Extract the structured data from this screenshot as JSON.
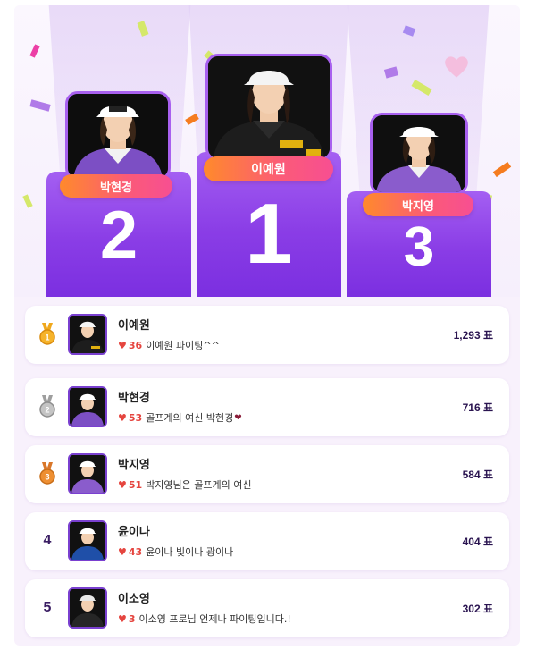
{
  "podium": [
    {
      "place": "1",
      "name": "이예원"
    },
    {
      "place": "2",
      "name": "박현경"
    },
    {
      "place": "3",
      "name": "박지영"
    }
  ],
  "ranking": [
    {
      "rank": "1",
      "rank_icon": "gold-medal-icon",
      "name": "이예원",
      "heart_count": "36",
      "message": "이예원 파이팅^^",
      "votes": "1,293 표"
    },
    {
      "rank": "2",
      "rank_icon": "silver-medal-icon",
      "name": "박현경",
      "heart_count": "53",
      "message": "골프계의 여신 박현경",
      "message_suffix_icon": "heart-icon",
      "votes": "716 표"
    },
    {
      "rank": "3",
      "rank_icon": "bronze-medal-icon",
      "name": "박지영",
      "heart_count": "51",
      "message": "박지영님은 골프계의 여신",
      "votes": "584 표"
    },
    {
      "rank": "4",
      "name": "윤이나",
      "heart_count": "43",
      "message": "윤이나 빛이나 광이나",
      "votes": "404 표"
    },
    {
      "rank": "5",
      "name": "이소영",
      "heart_count": "3",
      "message": "이소영 프로님 언제나 파이팅입니다.!",
      "votes": "302 표"
    }
  ],
  "colors": {
    "podium": "#8a3de6",
    "name_pill_start": "#ff8a2b",
    "name_pill_end": "#f74f92",
    "heart": "#e5453f",
    "gold": "#f0a81c",
    "silver": "#b8b8b8",
    "bronze": "#e98a2c"
  }
}
